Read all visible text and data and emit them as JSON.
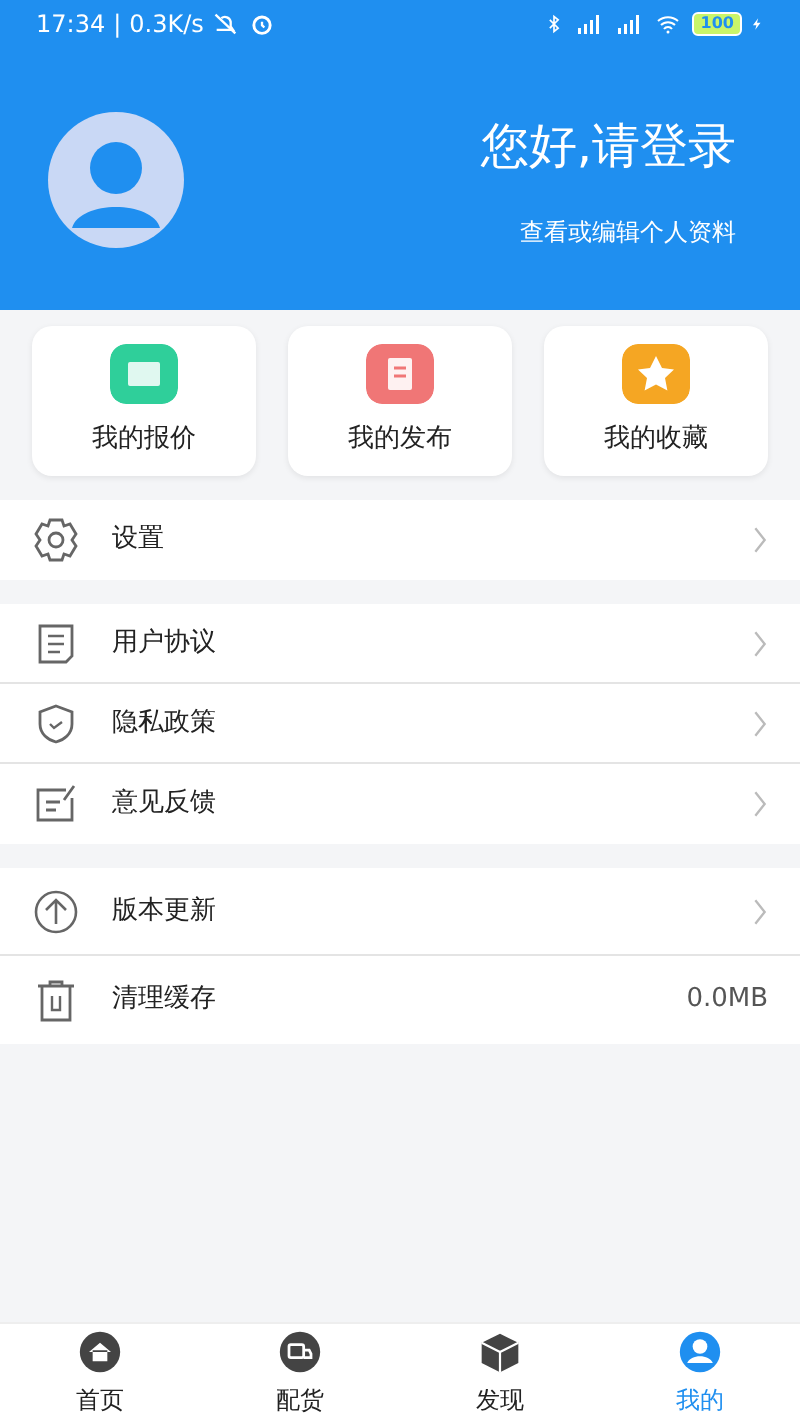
{
  "status_bar": {
    "time": "17:34",
    "separator": "|",
    "speed": "0.3K/s",
    "battery": "100"
  },
  "header": {
    "greeting": "您好,请登录",
    "subtitle": "查看或编辑个人资料"
  },
  "shortcuts": [
    {
      "label": "我的报价",
      "color": "#2fcf9a"
    },
    {
      "label": "我的发布",
      "color": "#f07676"
    },
    {
      "label": "我的收藏",
      "color": "#f5a623"
    }
  ],
  "menu_groups": [
    [
      {
        "label": "设置",
        "kind": "link"
      }
    ],
    [
      {
        "label": "用户协议",
        "kind": "link"
      },
      {
        "label": "隐私政策",
        "kind": "link"
      },
      {
        "label": "意见反馈",
        "kind": "link"
      }
    ],
    [
      {
        "label": "版本更新",
        "kind": "link"
      },
      {
        "label": "清理缓存",
        "kind": "value",
        "value": "0.0MB"
      }
    ]
  ],
  "tabs": [
    {
      "label": "首页",
      "selected": false
    },
    {
      "label": "配货",
      "selected": false
    },
    {
      "label": "发现",
      "selected": false
    },
    {
      "label": "我的",
      "selected": true
    }
  ]
}
